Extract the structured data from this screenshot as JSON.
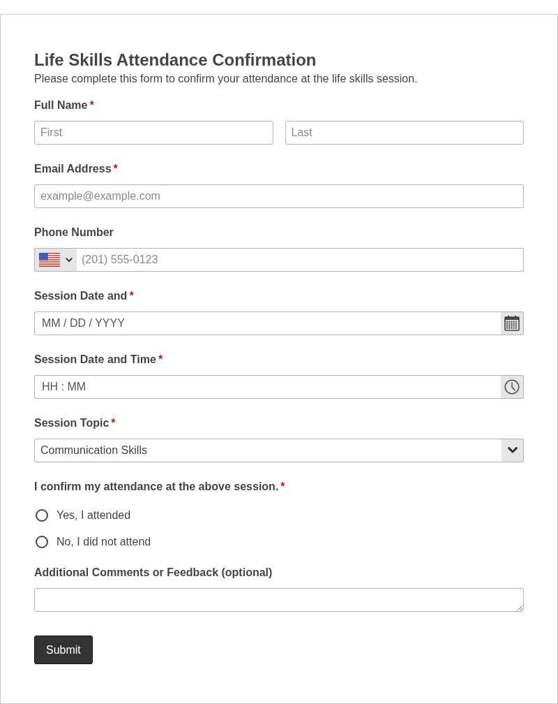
{
  "title": "Life Skills Attendance Confirmation",
  "description": "Please complete this form to confirm your attendance at the life skills session.",
  "fields": [
    {
      "kind": "name",
      "label": "Full Name",
      "required_mark": "*",
      "inputs": [
        {
          "placeholder": "First"
        },
        {
          "placeholder": "Last"
        }
      ]
    },
    {
      "kind": "text",
      "label": "Email Address",
      "required_mark": "*",
      "placeholder": "example@example.com"
    },
    {
      "kind": "phone",
      "label": "Phone Number",
      "placeholder": "(201) 555-0123"
    },
    {
      "kind": "date",
      "label": "Session Date and",
      "required_mark": "*",
      "placeholder": "MM / DD / YYYY"
    },
    {
      "kind": "time",
      "label": "Session Date and Time",
      "required_mark": "*",
      "placeholder": "HH : MM"
    },
    {
      "kind": "select",
      "label": "Session Topic",
      "required_mark": "*",
      "value": "Communication Skills"
    },
    {
      "kind": "radio",
      "label": "I confirm my attendance at the above session.",
      "required_mark": "*",
      "options": [
        {
          "label": "Yes, I attended",
          "selected": false
        },
        {
          "label": "No, I did not attend",
          "selected": false
        }
      ]
    },
    {
      "kind": "textarea",
      "label": "Additional Comments or Feedback (optional)"
    }
  ],
  "submit": "Submit"
}
